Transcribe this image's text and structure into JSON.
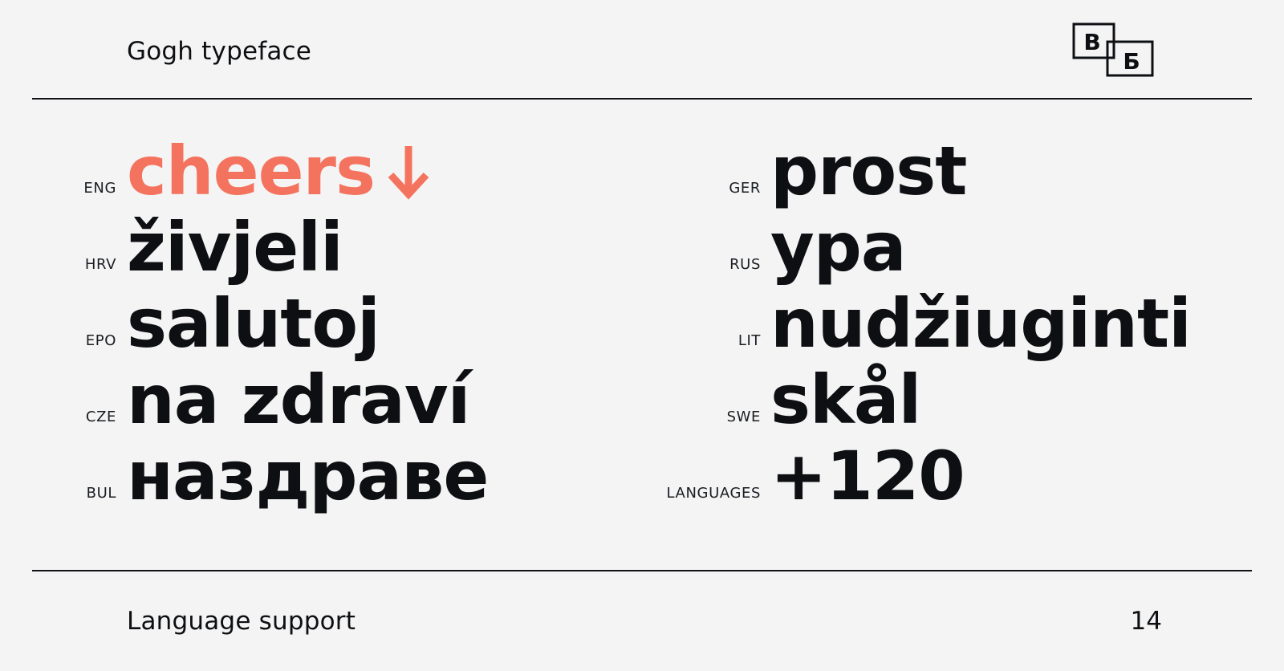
{
  "header": {
    "title": "Gogh typeface",
    "logo": {
      "letter_left": "В",
      "letter_right": "Б"
    }
  },
  "languages_left": [
    {
      "code": "ENG",
      "word": "cheers"
    },
    {
      "code": "HRV",
      "word": "živjeli"
    },
    {
      "code": "EPO",
      "word": "salutoj"
    },
    {
      "code": "CZE",
      "word": "na zdraví"
    },
    {
      "code": "BUL",
      "word": "наздраве"
    }
  ],
  "languages_right": [
    {
      "code": "GER",
      "word": "prost"
    },
    {
      "code": "RUS",
      "word": "ура"
    },
    {
      "code": "LIT",
      "word": "nudžiuginti"
    },
    {
      "code": "SWE",
      "word": "skål"
    },
    {
      "code": "LANGUAGES",
      "word": "+120"
    }
  ],
  "footer": {
    "title": "Language support",
    "page_number": "14"
  },
  "colors": {
    "accent": "#f4735f",
    "text": "#0d0f12",
    "background": "#f4f4f4"
  },
  "icons": {
    "accent_arrow": "arrow-down-icon"
  }
}
